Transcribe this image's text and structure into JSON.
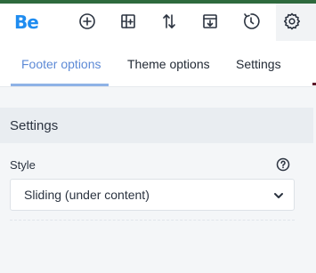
{
  "toolbar": {
    "logo_text": "Be",
    "icons": [
      "add-circle-icon",
      "add-section-icon",
      "sort-arrows-icon",
      "import-icon",
      "history-icon",
      "gear-icon"
    ]
  },
  "tabs": [
    {
      "label": "Footer options",
      "active": true
    },
    {
      "label": "Theme options",
      "active": false
    },
    {
      "label": "Settings",
      "active": false
    }
  ],
  "section": {
    "title": "Settings"
  },
  "field": {
    "label": "Style",
    "value": "Sliding (under content)",
    "help_icon": "help-circle-icon",
    "chevron_icon": "chevron-down-icon"
  },
  "colors": {
    "brand": "#1f8cf0",
    "active_tab": "#5d8ad6",
    "tab_underline": "#8eb2e6"
  }
}
